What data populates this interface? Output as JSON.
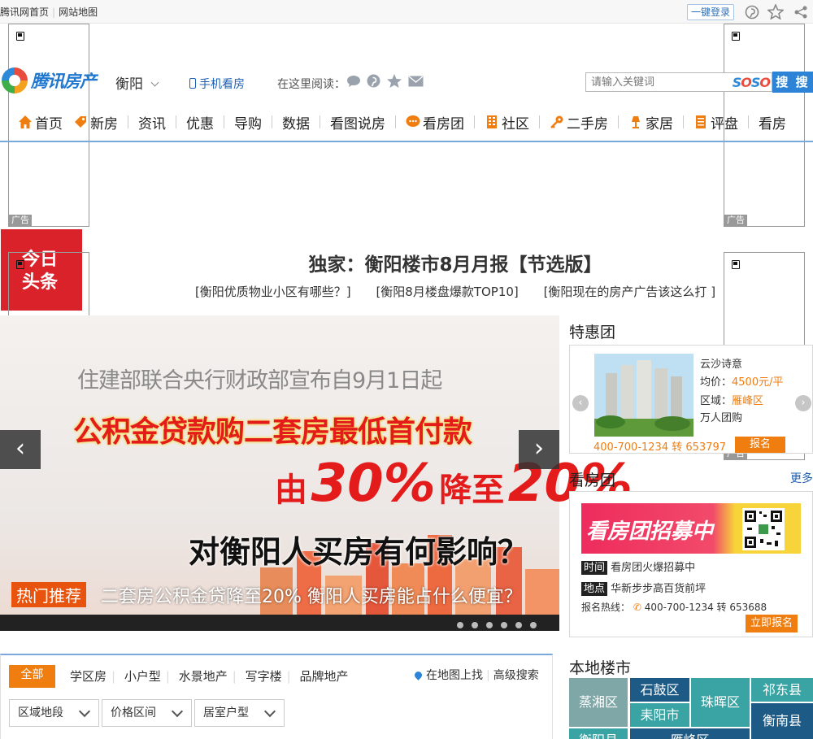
{
  "topbar": {
    "home_link": "腾讯网首页",
    "sitemap_link": "网站地图",
    "login_button": "一键登录"
  },
  "ads": {
    "tag": "广告"
  },
  "header": {
    "logo_text": "腾讯房产",
    "city": "衡阳",
    "mobile_link": "手机看房",
    "read_here_label": "在这里阅读：",
    "search_placeholder": "请输入关键词",
    "search_brand": "SOSO",
    "search_button": "搜 搜"
  },
  "nav": {
    "items": [
      "首页",
      "新房",
      "资讯",
      "优惠",
      "导购",
      "数据",
      "看图说房",
      "看房团",
      "社区",
      "二手房",
      "家居",
      "评盘",
      "看房"
    ]
  },
  "headline": {
    "badge_line1": "今日",
    "badge_line2": "头条",
    "title": "独家：衡阳楼市8月月报【节选版】",
    "links": [
      "[衡阳优质物业小区有哪些？]",
      "[衡阳8月楼盘爆款TOP10]",
      "[衡阳现在的房产广告该这么打 ]"
    ]
  },
  "banner": {
    "line1": "住建部联合央行财政部宣布自9月1日起",
    "line2": "公积金贷款购二套房最低首付款",
    "line3_a": "由",
    "line3_b": "30%",
    "line3_c": "降至",
    "line3_d": "20%",
    "line4": "对衡阳人买房有何影响？",
    "hot_tag": "热门推荐",
    "caption": "二套房公积金贷降至20% 衡阳人买房能占什么便宜？",
    "slide_count": 6
  },
  "tehui": {
    "title": "特惠团",
    "project_name": "云沙诗意",
    "price_label": "均价：",
    "price_value": "4500元/平",
    "district_label": "区域：",
    "district_value": "雁峰区",
    "group_text": "万人团购",
    "hotline": "400-700-1234 转 653797",
    "signup_button": "报名"
  },
  "kanfangtuan": {
    "title": "看房团",
    "more": "更多",
    "banner_text": "看房团招募中",
    "time_label": "时间",
    "time_value": "看房团火爆招募中",
    "place_label": "地点",
    "place_value": "华新步步高百货前坪",
    "hotline_label": "报名热线：",
    "hotline_value": "400-700-1234 转 653688",
    "signup_button": "立即报名"
  },
  "filter": {
    "tab_all": "全部",
    "tabs": [
      "学区房",
      "小户型",
      "水景地产",
      "写字楼",
      "品牌地产"
    ],
    "map_link": "在地图上找",
    "advanced_search": "高级搜索",
    "selects": [
      "区域地段",
      "价格区间",
      "居室户型"
    ]
  },
  "local": {
    "title": "本地楼市",
    "districts": [
      "蒸湘区",
      "石鼓区",
      "耒阳市",
      "珠晖区",
      "祁东县",
      "衡南县",
      "衡阳县",
      "雁峰区"
    ]
  },
  "colors": {
    "brand_blue": "#2d84d6",
    "accent_orange": "#ef7d0f",
    "headline_red": "#d9222a",
    "teal": "#3aa3a3",
    "navy": "#1d5a86"
  }
}
